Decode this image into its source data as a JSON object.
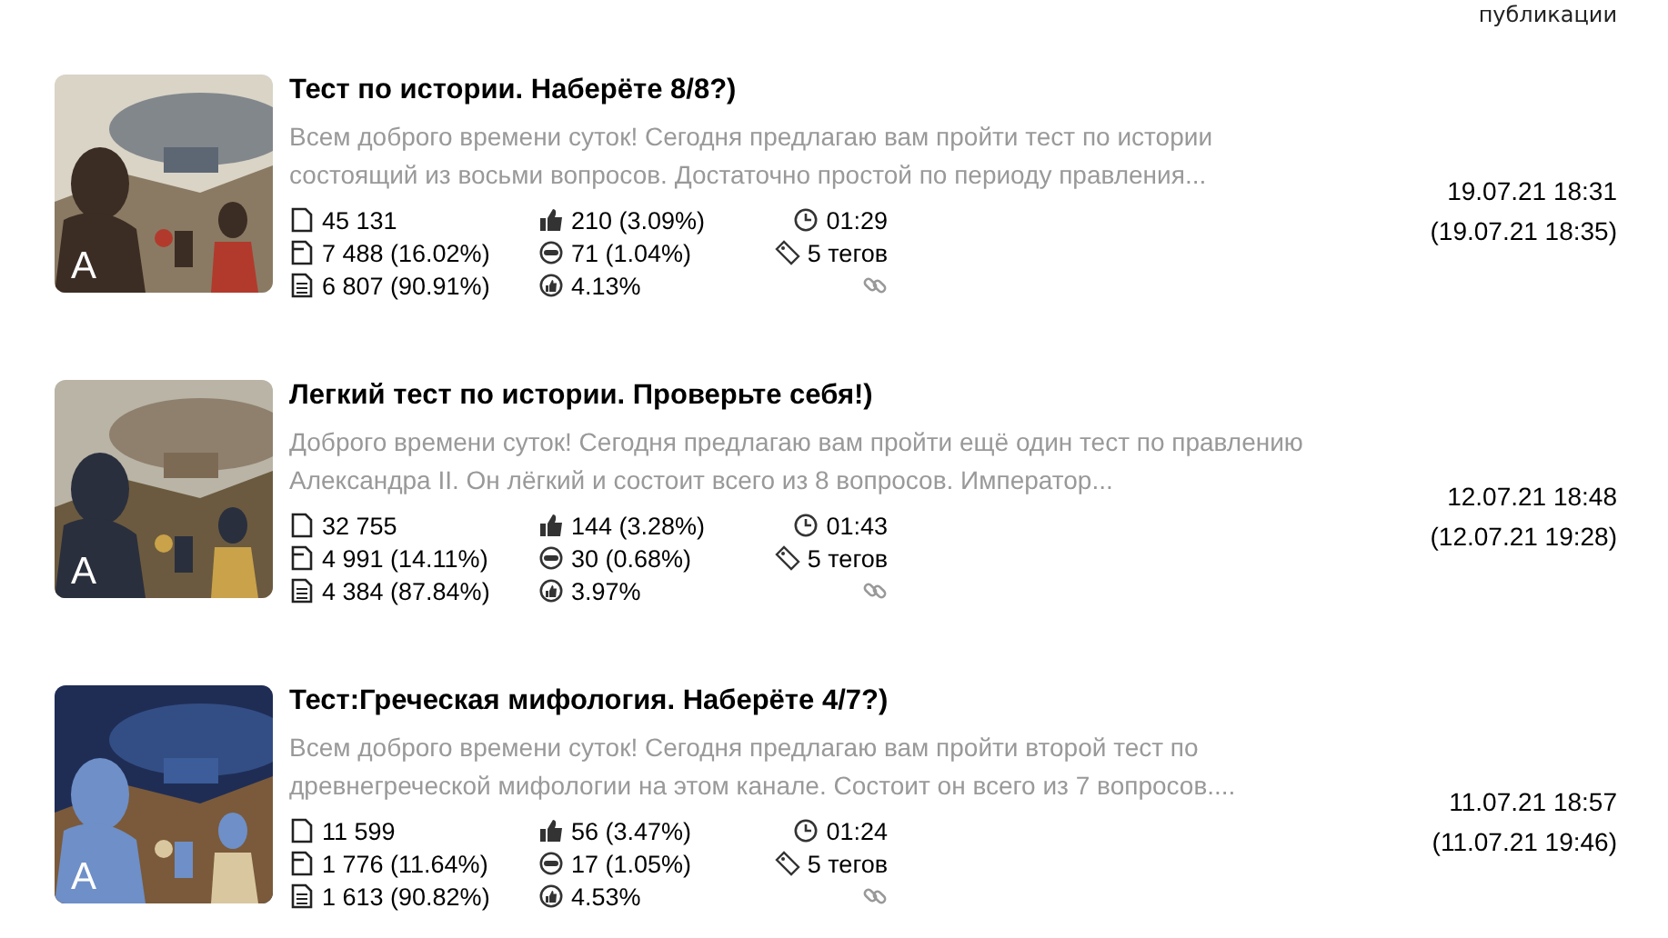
{
  "header": {
    "column_label": "публикации"
  },
  "articles": [
    {
      "title": "Тест по истории. Наберёте 8/8?)",
      "snippet": "Всем доброго времени суток! Сегодня предлагаю вам пройти тест по истории состоящий из восьми вопросов. Достаточно простой по периоду правления...",
      "thumbnail": {
        "kind": "picture",
        "badge": "A"
      },
      "views": "45 131",
      "impressions": "7 488 (16.02%)",
      "reads": "6 807 (90.91%)",
      "likes": "210 (3.09%)",
      "comments": "71 (1.04%)",
      "engagement": "4.13%",
      "read_time": "01:29",
      "tags": "5 тегов",
      "published": "19.07.21 18:31",
      "updated": "(19.07.21 18:35)"
    },
    {
      "title": "Легкий тест по истории. Проверьте себя!)",
      "snippet": "Доброго времени суток! Сегодня предлагаю вам пройти ещё один тест по правлению Александра II. Он лёгкий и состоит всего из 8 вопросов. Император...",
      "thumbnail": {
        "kind": "picture",
        "badge": "A"
      },
      "views": "32 755",
      "impressions": "4 991 (14.11%)",
      "reads": "4 384 (87.84%)",
      "likes": "144 (3.28%)",
      "comments": "30 (0.68%)",
      "engagement": "3.97%",
      "read_time": "01:43",
      "tags": "5 тегов",
      "published": "12.07.21 18:48",
      "updated": "(12.07.21 19:28)"
    },
    {
      "title": "Тест:Греческая мифология. Наберёте 4/7?)",
      "snippet": "Всем доброго времени суток! Сегодня предлагаю вам пройти второй тест по древнегреческой мифологии на этом канале. Состоит он всего из 7 вопросов....",
      "thumbnail": {
        "kind": "picture",
        "badge": "A"
      },
      "views": "11 599",
      "impressions": "1 776 (11.64%)",
      "reads": "1 613 (90.82%)",
      "likes": "56 (3.47%)",
      "comments": "17 (1.05%)",
      "engagement": "4.53%",
      "read_time": "01:24",
      "tags": "5 тегов",
      "published": "11.07.21 18:57",
      "updated": "(11.07.21 19:46)"
    }
  ]
}
